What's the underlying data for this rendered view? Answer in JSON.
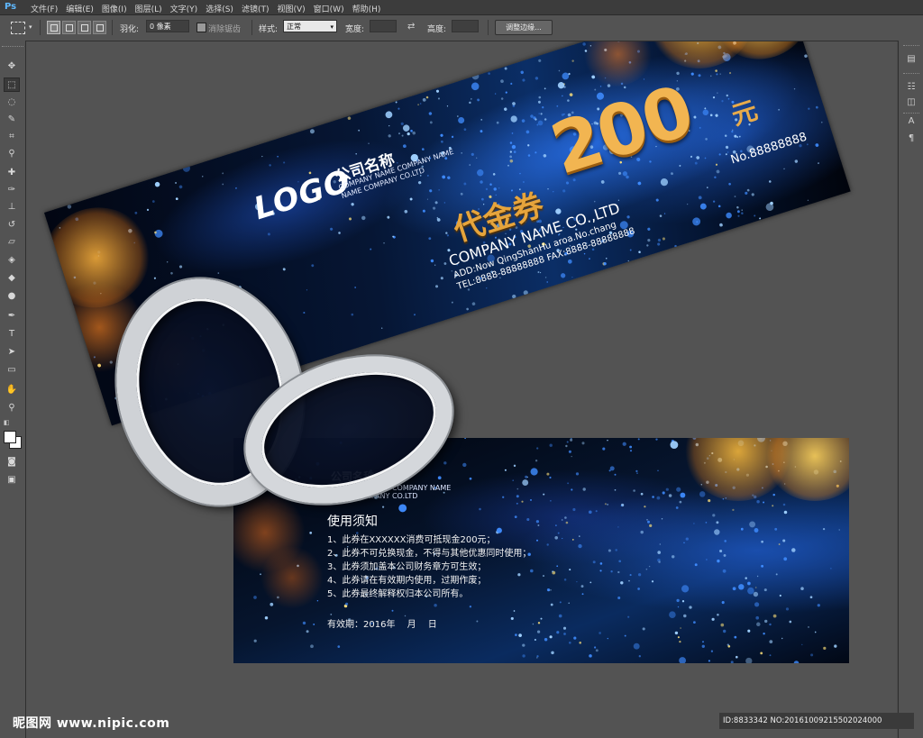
{
  "app": {
    "logo": "Ps",
    "menu": [
      "文件(F)",
      "编辑(E)",
      "图像(I)",
      "图层(L)",
      "文字(Y)",
      "选择(S)",
      "滤镜(T)",
      "视图(V)",
      "窗口(W)",
      "帮助(H)"
    ]
  },
  "options": {
    "feather_label": "羽化:",
    "feather_value": "0 像素",
    "antialias_label": "消除锯齿",
    "style_label": "样式:",
    "style_value": "正常",
    "width_label": "宽度:",
    "height_label": "高度:",
    "refine_button": "调整边缘..."
  },
  "voucher_front": {
    "logo": "LOGO",
    "company_cn": "公司名称",
    "company_en_line1": "COMPANY NAME COMPANY NAME",
    "company_en_line2": "NAME COMPANY CO.LTD",
    "title": "代金券",
    "amount": "200",
    "currency": "元",
    "serial": "No.88888888",
    "company_name": "COMPANY NAME CO.,LTD",
    "address": "ADD:Now QingShanHu aroa.No.chang",
    "tel_fax": "TEL:8888-88888888  FAX:8888-88888888"
  },
  "voucher_back": {
    "company_cn": "公司名称",
    "company_en_line1": "COMPANY NAME COMPANY NAME",
    "company_en_line2": "NAME COMPANY CO.LTD",
    "title": "使用须知",
    "rules": [
      "1、此券在XXXXXX消费可抵现金200元；",
      "2、此券不可兑换现金，不得与其他优惠同时使用；",
      "3、此券须加盖本公司财务章方可生效；",
      "4、此券请在有效期内使用，过期作废；",
      "5、此券最终解释权归本公司所有。"
    ],
    "validity": "有效期：2016年　 月　 日"
  },
  "watermark": {
    "left": "昵图网 www.nipic.com",
    "right": "ID:8833342 NO:20161009215502024000"
  },
  "colors": {
    "app_bg": "#535353",
    "gold": "#f2b551",
    "deep_blue": "#0b2e66"
  }
}
